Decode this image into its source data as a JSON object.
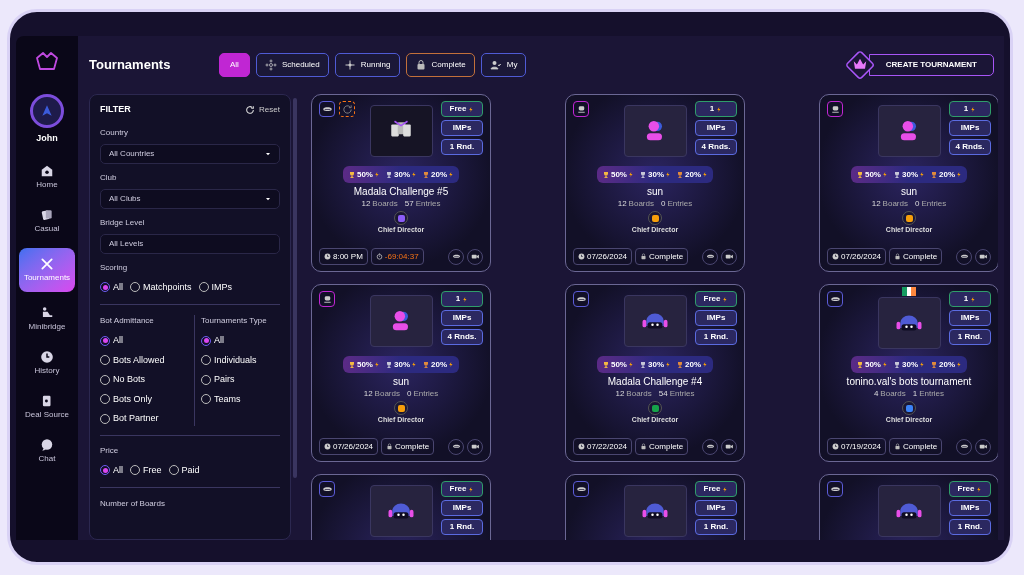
{
  "user": {
    "name": "John"
  },
  "nav": [
    {
      "label": "Home",
      "kind": "home",
      "selected": false
    },
    {
      "label": "Casual",
      "kind": "cards",
      "selected": false
    },
    {
      "label": "Tournaments",
      "kind": "swords",
      "selected": true
    },
    {
      "label": "Minibridge",
      "kind": "mini",
      "selected": false
    },
    {
      "label": "History",
      "kind": "clock",
      "selected": false
    },
    {
      "label": "Deal Source",
      "kind": "deal",
      "selected": false
    },
    {
      "label": "Chat",
      "kind": "chat",
      "selected": false
    }
  ],
  "page_title": "Tournaments",
  "tabs": [
    {
      "label": "All",
      "kind": "plain",
      "selected": true,
      "color": "#c026d3"
    },
    {
      "label": "Scheduled",
      "kind": "scheduled",
      "selected": false,
      "color": "#4f5bd5"
    },
    {
      "label": "Running",
      "kind": "running",
      "selected": false,
      "color": "#4f5bd5"
    },
    {
      "label": "Complete",
      "kind": "lock",
      "selected": false,
      "color": "#c2703a"
    },
    {
      "label": "My",
      "kind": "user",
      "selected": false,
      "color": "#4f5bd5"
    }
  ],
  "create_button": "CREATE TOURNAMENT",
  "filter": {
    "title": "FILTER",
    "reset": "Reset",
    "selects": [
      {
        "label": "Country",
        "value": "All Countries",
        "dropdown": true
      },
      {
        "label": "Club",
        "value": "All Clubs",
        "dropdown": true
      },
      {
        "label": "Bridge Level",
        "value": "All Levels",
        "dropdown": false
      }
    ],
    "scoring": {
      "label": "Scoring",
      "options": [
        {
          "label": "All",
          "selected": true
        },
        {
          "label": "Matchpoints",
          "selected": false
        },
        {
          "label": "IMPs",
          "selected": false
        }
      ]
    },
    "bot_admittance": {
      "label": "Bot Admittance",
      "options": [
        {
          "label": "All",
          "selected": true
        },
        {
          "label": "Bots Allowed",
          "selected": false
        },
        {
          "label": "No Bots",
          "selected": false
        },
        {
          "label": "Bots Only",
          "selected": false
        },
        {
          "label": "Bot Partner",
          "selected": false
        }
      ]
    },
    "tournaments_type": {
      "label": "Tournaments Type",
      "options": [
        {
          "label": "All",
          "selected": true
        },
        {
          "label": "Individuals",
          "selected": false
        },
        {
          "label": "Pairs",
          "selected": false
        },
        {
          "label": "Teams",
          "selected": false
        }
      ]
    },
    "price": {
      "label": "Price",
      "options": [
        {
          "label": "All",
          "selected": true
        },
        {
          "label": "Free",
          "selected": false
        },
        {
          "label": "Paid",
          "selected": false
        }
      ]
    },
    "boards_label": "Number of Boards"
  },
  "cards": [
    {
      "corner_icons": [
        {
          "kind": "mask"
        },
        {
          "kind": "refresh"
        }
      ],
      "flag": false,
      "image": {
        "kind": "banner"
      },
      "badges": [
        {
          "kind": "price",
          "text": "Free"
        },
        {
          "kind": "info",
          "text": "IMPs"
        },
        {
          "kind": "info",
          "text": "1 Rnd."
        }
      ],
      "prizes": [
        "50%",
        "30%",
        "20%"
      ],
      "title": "Madala Challenge #5",
      "boards": "12",
      "boards_label": "Boards",
      "entries": "57",
      "entries_label": "Entries",
      "director": {
        "color": "#8b5cf6",
        "label": "Chief Director"
      },
      "time": {
        "kind": "clock",
        "text": "8:00 PM"
      },
      "status": {
        "kind": "timer",
        "text": "-69:04:37"
      }
    },
    {
      "corner_icons": [
        {
          "kind": "bots"
        }
      ],
      "flag": false,
      "image": {
        "kind": "person"
      },
      "badges": [
        {
          "kind": "price",
          "text": "1"
        },
        {
          "kind": "info",
          "text": "IMPs"
        },
        {
          "kind": "info",
          "text": "4 Rnds."
        }
      ],
      "prizes": [
        "50%",
        "30%",
        "20%"
      ],
      "title": "sun",
      "boards": "12",
      "boards_label": "Boards",
      "entries": "0",
      "entries_label": "Entries",
      "director": {
        "color": "#f59e0b",
        "label": "Chief Director"
      },
      "time": {
        "kind": "clock",
        "text": "07/26/2024"
      },
      "status": {
        "kind": "lock",
        "text": "Complete"
      }
    },
    {
      "corner_icons": [
        {
          "kind": "bots"
        }
      ],
      "flag": false,
      "image": {
        "kind": "person"
      },
      "badges": [
        {
          "kind": "price",
          "text": "1"
        },
        {
          "kind": "info",
          "text": "IMPs"
        },
        {
          "kind": "info",
          "text": "4 Rnds."
        }
      ],
      "prizes": [
        "50%",
        "30%",
        "20%"
      ],
      "title": "sun",
      "boards": "12",
      "boards_label": "Boards",
      "entries": "0",
      "entries_label": "Entries",
      "director": {
        "color": "#f59e0b",
        "label": "Chief Director"
      },
      "time": {
        "kind": "clock",
        "text": "07/26/2024"
      },
      "status": {
        "kind": "lock",
        "text": "Complete"
      }
    },
    {
      "corner_icons": [
        {
          "kind": "bots"
        }
      ],
      "flag": false,
      "image": {
        "kind": "person"
      },
      "badges": [
        {
          "kind": "price",
          "text": "1"
        },
        {
          "kind": "info",
          "text": "IMPs"
        },
        {
          "kind": "info",
          "text": "4 Rnds."
        }
      ],
      "prizes": [
        "50%",
        "30%",
        "20%"
      ],
      "title": "sun",
      "boards": "12",
      "boards_label": "Boards",
      "entries": "0",
      "entries_label": "Entries",
      "director": {
        "color": "#f59e0b",
        "label": "Chief Director"
      },
      "time": {
        "kind": "clock",
        "text": "07/26/2024"
      },
      "status": {
        "kind": "lock",
        "text": "Complete"
      }
    },
    {
      "corner_icons": [
        {
          "kind": "mask"
        }
      ],
      "flag": false,
      "image": {
        "kind": "bot"
      },
      "badges": [
        {
          "kind": "price",
          "text": "Free"
        },
        {
          "kind": "info",
          "text": "IMPs"
        },
        {
          "kind": "info",
          "text": "1 Rnd."
        }
      ],
      "prizes": [
        "50%",
        "30%",
        "20%"
      ],
      "title": "Madala Challenge #4",
      "boards": "12",
      "boards_label": "Boards",
      "entries": "54",
      "entries_label": "Entries",
      "director": {
        "color": "#16a34a",
        "label": "Chief Director"
      },
      "time": {
        "kind": "clock",
        "text": "07/22/2024"
      },
      "status": {
        "kind": "lock",
        "text": "Complete"
      }
    },
    {
      "corner_icons": [
        {
          "kind": "mask"
        }
      ],
      "flag": true,
      "image": {
        "kind": "bot"
      },
      "badges": [
        {
          "kind": "price",
          "text": "1"
        },
        {
          "kind": "info",
          "text": "IMPs"
        },
        {
          "kind": "info",
          "text": "1 Rnd."
        }
      ],
      "prizes": [
        "50%",
        "30%",
        "20%"
      ],
      "title": "tonino.val's bots tournament",
      "boards": "4",
      "boards_label": "Boards",
      "entries": "1",
      "entries_label": "Entries",
      "director": {
        "color": "#3b82f6",
        "label": "Chief Director"
      },
      "time": {
        "kind": "clock",
        "text": "07/19/2024"
      },
      "status": {
        "kind": "lock",
        "text": "Complete"
      }
    },
    {
      "corner_icons": [
        {
          "kind": "mask"
        }
      ],
      "flag": false,
      "image": {
        "kind": "bot"
      },
      "badges": [
        {
          "kind": "price",
          "text": "Free"
        },
        {
          "kind": "info",
          "text": "IMPs"
        },
        {
          "kind": "info",
          "text": "1 Rnd."
        }
      ]
    },
    {
      "corner_icons": [
        {
          "kind": "mask"
        }
      ],
      "flag": false,
      "image": {
        "kind": "bot"
      },
      "badges": [
        {
          "kind": "price",
          "text": "Free"
        },
        {
          "kind": "info",
          "text": "IMPs"
        },
        {
          "kind": "info",
          "text": "1 Rnd."
        }
      ]
    },
    {
      "corner_icons": [
        {
          "kind": "mask"
        }
      ],
      "flag": false,
      "image": {
        "kind": "bot"
      },
      "badges": [
        {
          "kind": "price",
          "text": "Free"
        },
        {
          "kind": "info",
          "text": "IMPs"
        },
        {
          "kind": "info",
          "text": "1 Rnd."
        }
      ]
    }
  ]
}
